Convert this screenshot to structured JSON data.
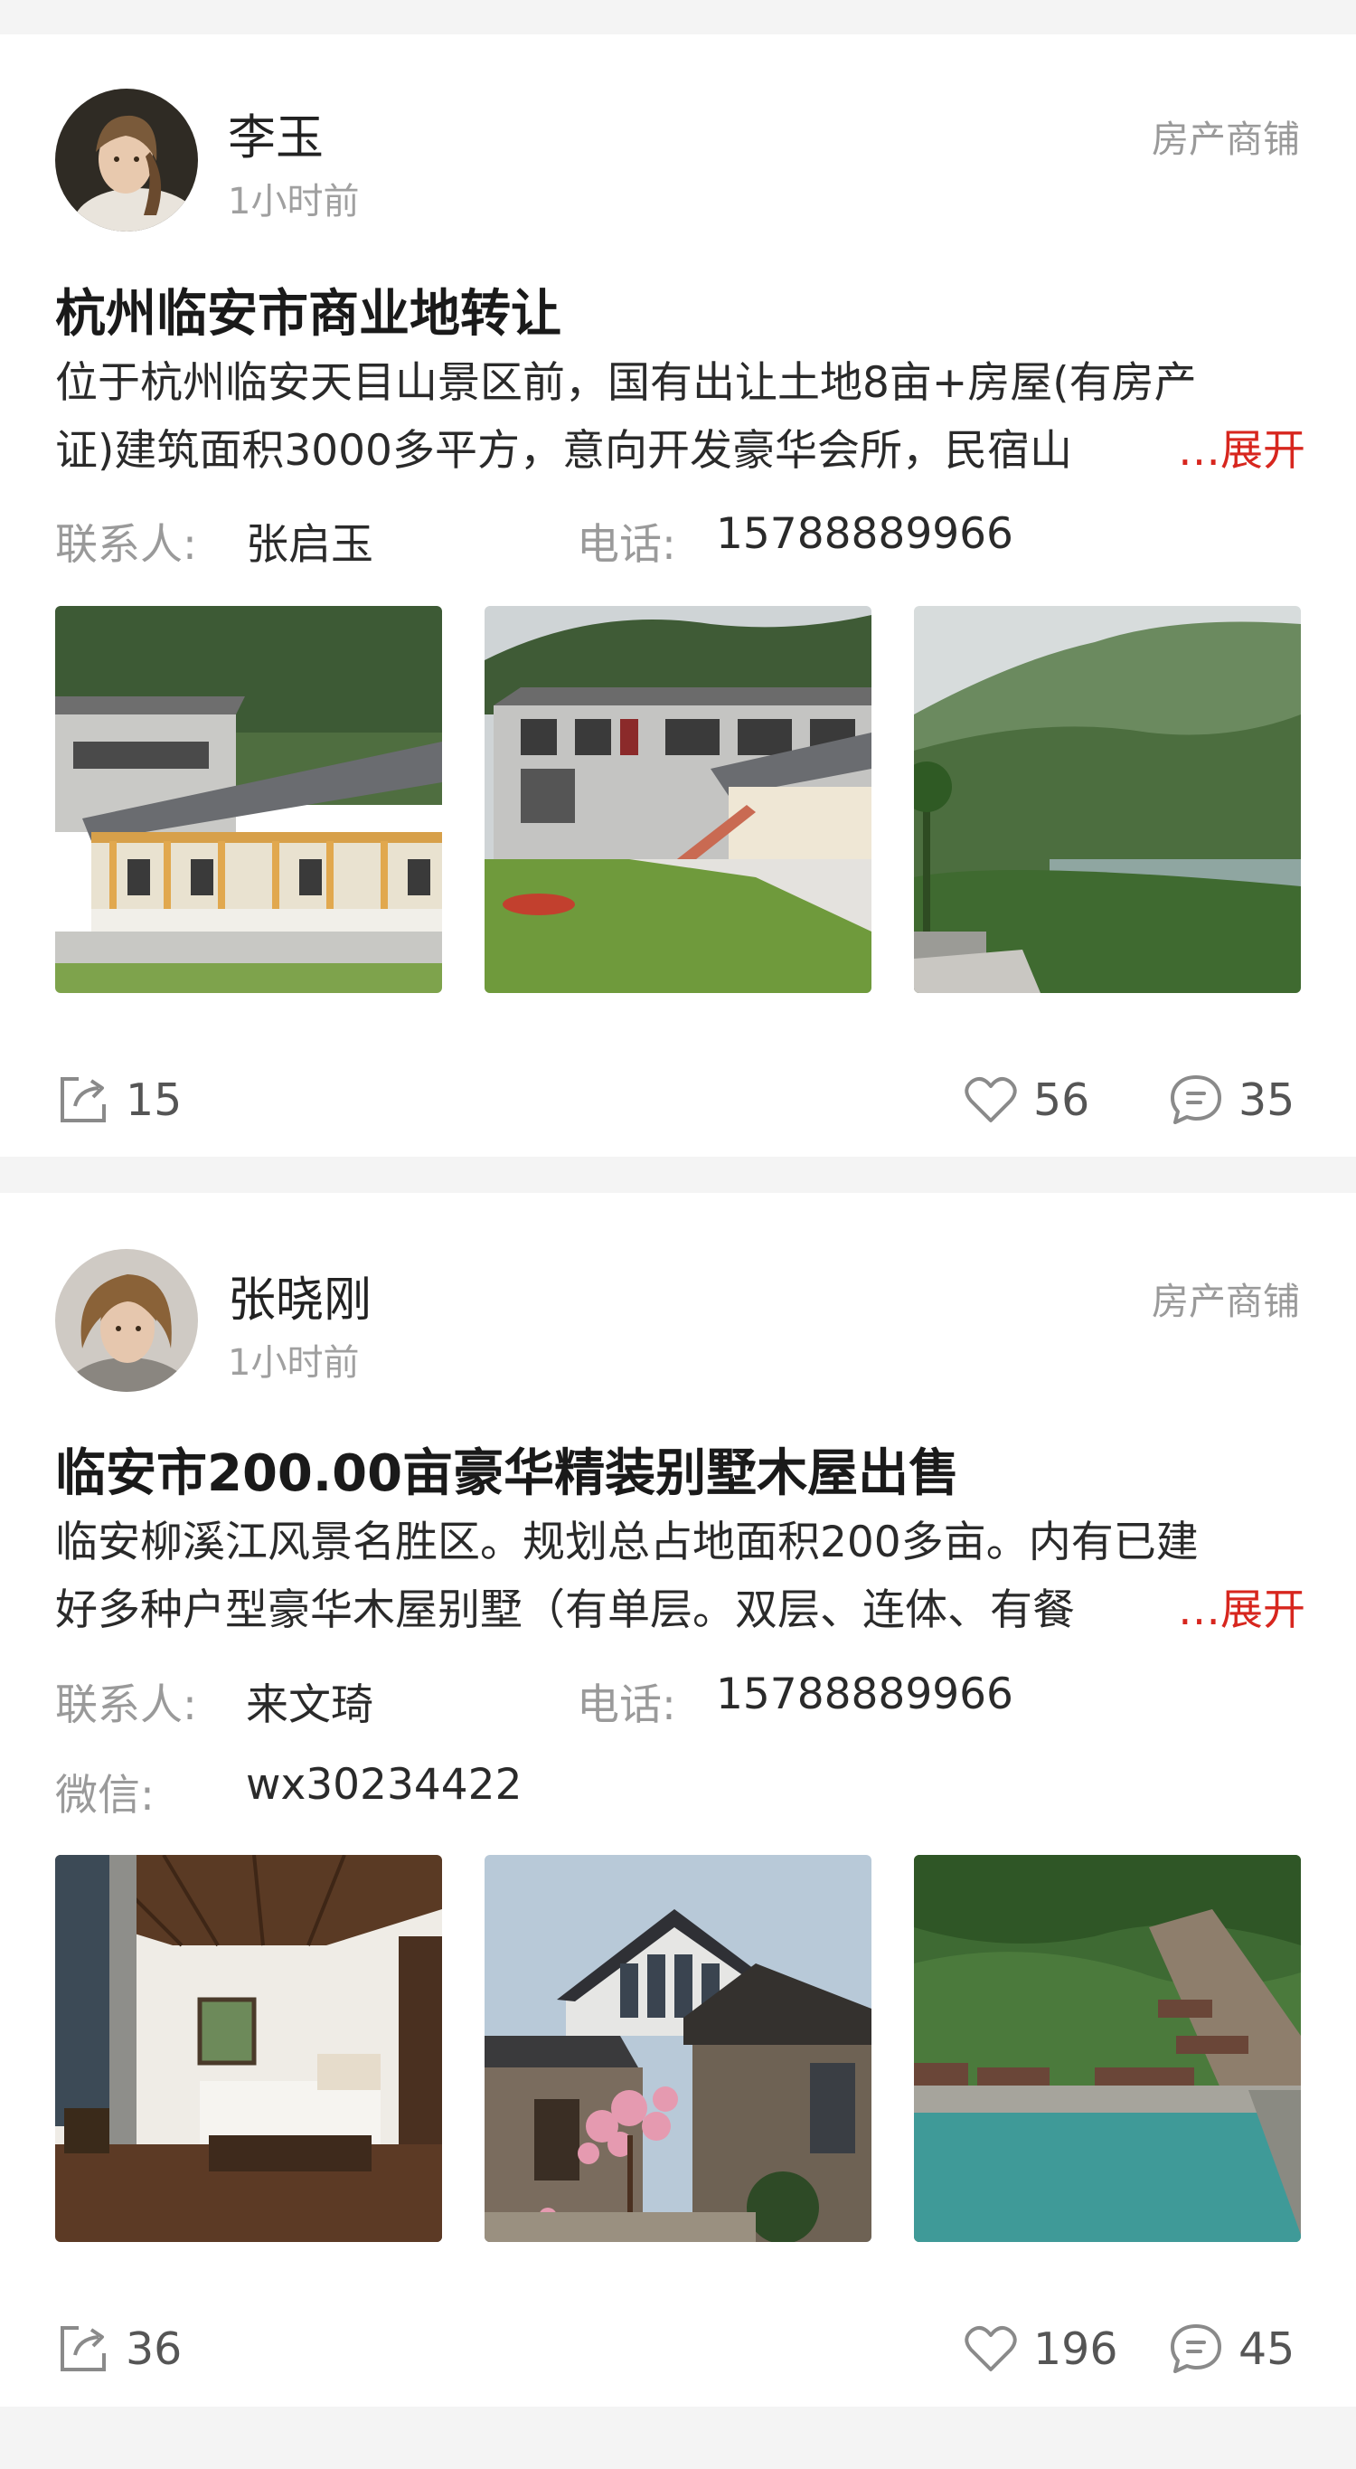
{
  "posts": [
    {
      "user": {
        "name": "李玉",
        "time": "1小时前"
      },
      "category": "房产商铺",
      "title": "杭州临安市商业地转让",
      "desc_line1": "位于杭州临安天目山景区前，国有出让土地8亩+房屋(有房产",
      "desc_line2": "证)建筑面积3000多平方，意向开发豪华会所，民宿山",
      "more_label": "…展开",
      "contact_label": "联系人:",
      "contact_name": "张启玉",
      "phone_label": "电话:",
      "phone": "15788889966",
      "shares": "15",
      "likes": "56",
      "comments": "35",
      "photos": [
        "building-photo",
        "building-photo",
        "mountain-lake-photo"
      ]
    },
    {
      "user": {
        "name": "张晓刚",
        "time": "1小时前"
      },
      "category": "房产商铺",
      "title": "临安市200.00亩豪华精装别墅木屋出售",
      "desc_line1": "临安柳溪江风景名胜区。规划总占地面积200多亩。内有已建",
      "desc_line2": "好多种户型豪华木屋别墅（有单层。双层、连体、有餐",
      "more_label": "…展开",
      "contact_label": "联系人:",
      "contact_name": "来文琦",
      "phone_label": "电话:",
      "phone": "15788889966",
      "wechat_label": "微信:",
      "wechat": "wx30234422",
      "shares": "36",
      "likes": "196",
      "comments": "45",
      "photos": [
        "bedroom-photo",
        "stone-house-photo",
        "lakeside-aerial-photo"
      ]
    }
  ],
  "colors": {
    "accent": "#d7261e",
    "muted": "#9a9a9a",
    "text": "#2a2a2a"
  },
  "icons": {
    "share": "share-icon",
    "like": "heart-icon",
    "comment": "comment-icon"
  }
}
